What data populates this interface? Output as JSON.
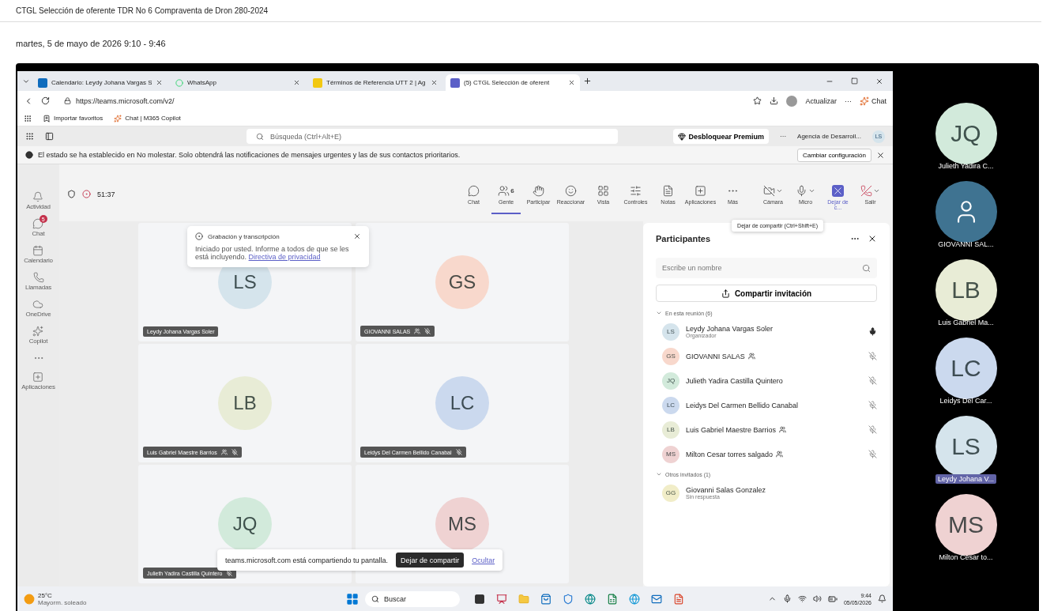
{
  "page": {
    "title": "CTGL Selección de oferente TDR No 6 Compraventa de Dron 280-2024",
    "date": "martes, 5 de mayo de 2026 9:10 - 9:46"
  },
  "browser": {
    "tabs": [
      {
        "kind": "calendar",
        "label": "Calendario: Leydy Johana Vargas S",
        "selected": false
      },
      {
        "kind": "whatsapp",
        "label": "WhatsApp",
        "selected": false
      },
      {
        "kind": "document",
        "label": "Términos de Referencia UTT 2 | Ag",
        "selected": false
      },
      {
        "kind": "teams",
        "label": "(5) CTGL Selección de oferent",
        "selected": true
      }
    ],
    "url": "https://teams.microsoft.com/v2/",
    "update_label": "Actualizar",
    "update_more": "···",
    "chat_label": "Chat",
    "favorites": [
      {
        "kind": "import",
        "label": "Importar favoritos"
      },
      {
        "kind": "copilot",
        "label": "Chat | M365 Copilot"
      }
    ]
  },
  "teams_header": {
    "search_placeholder": "Búsqueda (Ctrl+Alt+E)",
    "premium": "Desbloquear Premium",
    "more": "···",
    "org": "Agencia de Desarroll...",
    "avatar": "LS"
  },
  "notice": {
    "text": "El estado se ha establecido en No molestar. Solo obtendrá las notificaciones de mensajes urgentes y las de sus contactos prioritarios.",
    "button": "Cambiar configuración"
  },
  "rail": [
    {
      "kind": "bell",
      "label": "Actividad",
      "selected": false
    },
    {
      "kind": "chat",
      "label": "Chat",
      "badge": "5",
      "selected": false
    },
    {
      "kind": "calendar",
      "label": "Calendario",
      "selected": false
    },
    {
      "kind": "calls",
      "label": "Llamadas",
      "selected": false
    },
    {
      "kind": "cloud",
      "label": "OneDrive",
      "selected": false
    },
    {
      "kind": "copilot",
      "label": "Copilot",
      "selected": false
    },
    {
      "kind": "more",
      "selected": false
    },
    {
      "kind": "apps",
      "label": "Aplicaciones",
      "selected": false
    }
  ],
  "meeting_bar": {
    "timer": "51:37",
    "recording": true,
    "items": [
      {
        "kind": "chat",
        "label": "Chat",
        "selected": false
      },
      {
        "kind": "people",
        "label": "Gente",
        "count": "6",
        "selected": true
      },
      {
        "kind": "hand",
        "label": "Participar",
        "selected": false
      },
      {
        "kind": "react",
        "label": "Reaccionar",
        "selected": false
      },
      {
        "kind": "view",
        "label": "Vista",
        "selected": false
      },
      {
        "kind": "controls",
        "label": "Controles",
        "selected": false
      },
      {
        "kind": "notes",
        "label": "Notas",
        "selected": false
      },
      {
        "kind": "apps",
        "label": "Aplicaciones",
        "selected": false
      },
      {
        "kind": "more",
        "label": "Más",
        "selected": false
      },
      {
        "kind": "camera_off",
        "label": "Cámara",
        "caret": true,
        "selected": false
      },
      {
        "kind": "mic",
        "label": "Micro",
        "caret": true,
        "selected": false
      },
      {
        "kind": "stop_share",
        "label": "Dejar de c...",
        "selected": true
      },
      {
        "kind": "leave",
        "label": "Salir",
        "caret": true,
        "selected": false
      }
    ]
  },
  "tooltip": "Dejar de compartir (Ctrl+Shift+E)",
  "tiles": [
    {
      "initials": "LS",
      "name": "Leydy Johana Vargas Soler",
      "color": "#d5e4ec",
      "external": false,
      "muted": false
    },
    {
      "initials": "GS",
      "name": "GIOVANNI SALAS",
      "color": "#f8d8cc",
      "external": true,
      "muted": true
    },
    {
      "initials": "LB",
      "name": "Luis Gabriel Maestre Barrios",
      "color": "#e8ecd6",
      "external": true,
      "muted": true
    },
    {
      "initials": "LC",
      "name": "Leidys Del Carmen Bellido Canabal",
      "color": "#cbd9ee",
      "external": false,
      "muted": true
    },
    {
      "initials": "JQ",
      "name": "Julieth Yadira Castilla Quintero",
      "color": "#d2eadb",
      "external": false,
      "muted": true
    },
    {
      "initials": "MS",
      "color": "#efd2d2"
    }
  ],
  "recording_popup": {
    "title": "Grabación y transcripción",
    "body": "Iniciado por usted. Informe a todos de que se les está incluyendo.",
    "link": "Directiva de privacidad"
  },
  "share_bar": {
    "text": "teams.microsoft.com está compartiendo tu pantalla.",
    "stop": "Dejar de compartir",
    "hide": "Ocultar"
  },
  "participants": {
    "title": "Participantes",
    "search_placeholder": "Escribe un nombre",
    "invite": "Compartir invitación",
    "groups": [
      {
        "label": "En esta reunión (6)",
        "expanded": true,
        "people": [
          {
            "initials": "LS",
            "name": "Leydy Johana Vargas Soler",
            "subtitle": "Organizador",
            "color": "#d5e4ec",
            "external": false,
            "muted": false
          },
          {
            "initials": "GS",
            "name": "GIOVANNI SALAS",
            "color": "#f8d8cc",
            "external": true,
            "muted": true
          },
          {
            "initials": "JQ",
            "name": "Julieth Yadira Castilla Quintero",
            "color": "#d2eadb",
            "external": false,
            "muted": true
          },
          {
            "initials": "LC",
            "name": "Leidys Del Carmen Bellido Canabal",
            "color": "#cbd9ee",
            "external": false,
            "muted": true
          },
          {
            "initials": "LB",
            "name": "Luis Gabriel Maestre Barrios",
            "color": "#e8ecd6",
            "external": true,
            "muted": true
          },
          {
            "initials": "MS",
            "name": "Milton Cesar torres salgado",
            "color": "#efd2d2",
            "external": true,
            "muted": true
          }
        ]
      },
      {
        "label": "Otros invitados (1)",
        "expanded": true,
        "people": [
          {
            "initials": "GG",
            "name": "Giovanni Salas Gonzalez",
            "subtitle": "Sin respuesta",
            "color": "#f1edc8",
            "external": false
          }
        ]
      }
    ]
  },
  "gallery": [
    {
      "kind": "initials",
      "initials": "JQ",
      "name": "Julieth Yadira C...",
      "color": "#d2eadb",
      "selected": false
    },
    {
      "kind": "icon",
      "name": "GIOVANNI SAL...",
      "color": "#3f7391",
      "selected": false
    },
    {
      "kind": "initials",
      "initials": "LB",
      "name": "Luis Gabriel Ma...",
      "color": "#e8ecd6",
      "selected": false
    },
    {
      "kind": "initials",
      "initials": "LC",
      "name": "Leidys Del Car...",
      "color": "#cbd9ee",
      "selected": false
    },
    {
      "kind": "initials",
      "initials": "LS",
      "name": "Leydy Johana V...",
      "color": "#d5e4ec",
      "selected": true
    },
    {
      "kind": "initials",
      "initials": "MS",
      "name": "Milton Cesar to...",
      "color": "#efd2d2",
      "selected": false
    }
  ],
  "taskbar": {
    "temperature": "25°C",
    "weather": "Mayorm. soleado",
    "search": "Buscar",
    "time": "9:44",
    "date": "05/05/2026"
  }
}
